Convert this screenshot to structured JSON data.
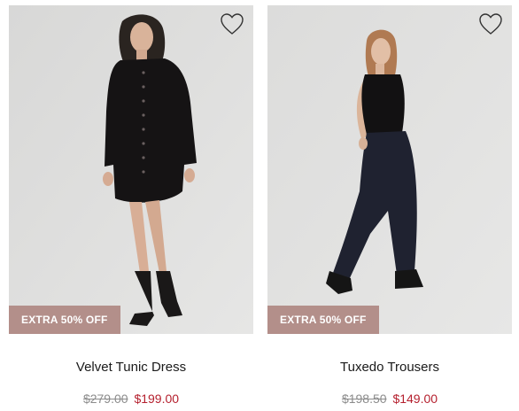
{
  "products": [
    {
      "name": "Velvet Tunic Dress",
      "badge": "EXTRA 50% OFF",
      "original_price": "$279.00",
      "sale_price": "$199.00",
      "image_subject": "model wearing black velvet tunic dress with ankle boots",
      "wishlist_icon": "heart-outline-icon"
    },
    {
      "name": "Tuxedo Trousers",
      "badge": "EXTRA 50% OFF",
      "original_price": "$198.50",
      "sale_price": "$149.00",
      "image_subject": "model wearing black sleeveless top and navy pleated trousers with loafers",
      "wishlist_icon": "heart-outline-icon"
    }
  ],
  "colors": {
    "badge_bg": "#b38f8a",
    "sale_price": "#b5202e",
    "original_price": "#8c8c8c",
    "photo_bg": "#e0e0df"
  }
}
